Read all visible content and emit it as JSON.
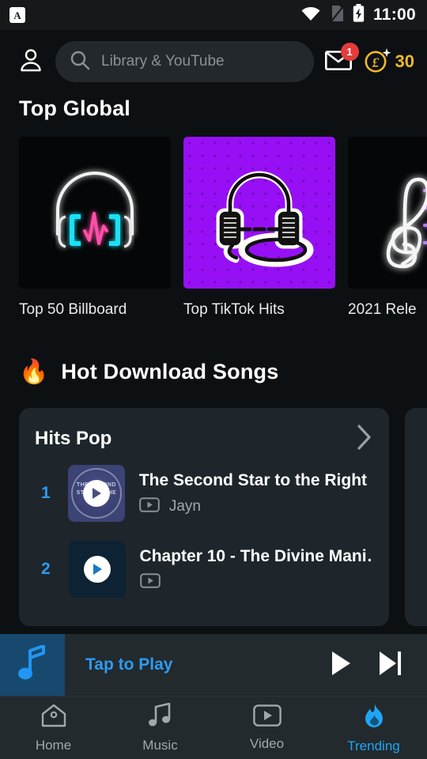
{
  "statusbar": {
    "app_notification_icon": "letter-a-app-icon",
    "app_notification_letter": "A",
    "wifi_icon": "wifi-icon",
    "sim_icon": "no-sim-icon",
    "battery_icon": "battery-charging-icon",
    "time": "11:00"
  },
  "header": {
    "profile_icon": "person-icon",
    "search": {
      "icon": "search-icon",
      "placeholder": "Library & YouTube",
      "value": ""
    },
    "mail": {
      "icon": "mail-icon",
      "badge": "1"
    },
    "coins": {
      "icon": "pound-coin-icon",
      "sparkle_icon": "sparkle-icon",
      "amount": "30",
      "color": "#f0b92a"
    }
  },
  "sections": {
    "top_global": {
      "title": "Top Global",
      "cards": [
        {
          "label": "Top 50 Billboard",
          "art": "neon-headphones-dark"
        },
        {
          "label": "Top TikTok Hits",
          "art": "purple-headphones"
        },
        {
          "label": "2021 Rele",
          "art": "neon-treble-clef"
        }
      ]
    },
    "hot_downloads": {
      "icon": "fire-emoji",
      "icon_glyph": "🔥",
      "title": "Hot Download Songs",
      "playlists": [
        {
          "title": "Hits Pop",
          "chevron_icon": "chevron-right-icon",
          "tracks": [
            {
              "index": "1",
              "title": "The Second Star to the Right …",
              "artist": "Jayn",
              "source_icon": "youtube-icon",
              "thumb": "blue-circle-play",
              "thumb_text": "THE SECOND STAR TO THE RIGHT"
            },
            {
              "index": "2",
              "title": "Chapter 10 - The Divine Mani…",
              "artist": "",
              "source_icon": "youtube-icon",
              "thumb": "dark-blue-play",
              "thumb_text": ""
            }
          ]
        },
        {
          "title": "",
          "chevron_icon": "chevron-right-icon",
          "tracks": []
        }
      ]
    }
  },
  "miniplayer": {
    "art_icon": "music-note-icon",
    "label": "Tap to Play",
    "label_color": "#2e9bf0",
    "play_icon": "play-icon",
    "next_icon": "skip-next-icon"
  },
  "bottomnav": {
    "items": [
      {
        "label": "Home",
        "icon": "home-icon",
        "active": false
      },
      {
        "label": "Music",
        "icon": "music-note-icon",
        "active": false
      },
      {
        "label": "Video",
        "icon": "video-icon",
        "active": false
      },
      {
        "label": "Trending",
        "icon": "flame-icon",
        "active": true
      }
    ],
    "active_color": "#1fa6f5",
    "inactive_color": "#a2a7ab"
  }
}
